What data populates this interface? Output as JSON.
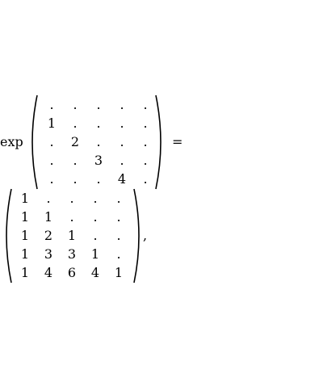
{
  "equation": {
    "operator": "exp",
    "equals": "=",
    "trailing": ",",
    "lhs_matrix": [
      [
        ".",
        ".",
        ".",
        ".",
        "."
      ],
      [
        "1",
        ".",
        ".",
        ".",
        "."
      ],
      [
        ".",
        "2",
        ".",
        ".",
        "."
      ],
      [
        ".",
        ".",
        "3",
        ".",
        "."
      ],
      [
        ".",
        ".",
        ".",
        "4",
        "."
      ]
    ],
    "rhs_matrix": [
      [
        "1",
        ".",
        ".",
        ".",
        "."
      ],
      [
        "1",
        "1",
        ".",
        ".",
        "."
      ],
      [
        "1",
        "2",
        "1",
        ".",
        "."
      ],
      [
        "1",
        "3",
        "3",
        "1",
        "."
      ],
      [
        "1",
        "4",
        "6",
        "4",
        "1"
      ]
    ]
  }
}
